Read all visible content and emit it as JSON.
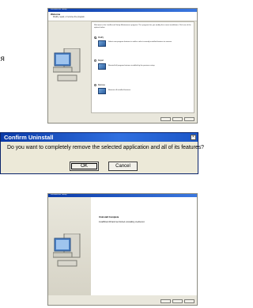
{
  "side_text": "я",
  "installer_top": {
    "title": "LiveRecord Setup",
    "header_title": "Welcome",
    "header_subtitle": "Modify, repair, or remove the program.",
    "intro": "Welcome to the LiveRecord Setup Maintenance program. This program lets you modify the current installation. Click one of the options below.",
    "options": [
      {
        "label": "Modify",
        "desc": "Select new program features to add or select currently installed features to remove.",
        "selected": true
      },
      {
        "label": "Repair",
        "desc": "Reinstall all program features installed by the previous setup.",
        "selected": false
      },
      {
        "label": "Remove",
        "desc": "Remove all installed features.",
        "selected": false
      }
    ]
  },
  "dialog": {
    "title": "Confirm Uninstall",
    "message": "Do you want to completely remove the selected application and all of its features?",
    "ok_label": "OK",
    "cancel_label": "Cancel",
    "close_glyph": "×"
  },
  "installer_bottom": {
    "title": "LiveRecord Setup",
    "heading": "Uninstall Complete",
    "message": "InstallShield Wizard has finished uninstalling LiveRecord."
  }
}
